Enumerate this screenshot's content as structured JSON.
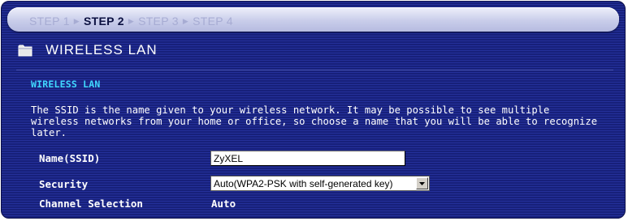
{
  "steps": [
    {
      "label": "STEP 1",
      "active": false
    },
    {
      "label": "STEP 2",
      "active": true
    },
    {
      "label": "STEP 3",
      "active": false
    },
    {
      "label": "STEP 4",
      "active": false
    }
  ],
  "section": {
    "title": "WIRELESS LAN",
    "icon": "folder-icon"
  },
  "subsection": {
    "title": "WIRELESS LAN"
  },
  "description": "The SSID is the name given to your wireless network. It may be possible to see multiple wireless networks from your home or office, so choose a name that you will be able to recognize later.",
  "form": {
    "ssid": {
      "label": "Name(SSID)",
      "value": "ZyXEL"
    },
    "security": {
      "label": "Security",
      "value": "Auto(WPA2-PSK with self-generated key)"
    },
    "channel": {
      "label": "Channel Selection",
      "value": "Auto"
    }
  },
  "colors": {
    "background": "#1f2a8a",
    "accent_subtitle": "#40d8ff",
    "text": "#ffffff",
    "active_step": "#0b1040",
    "inactive_step": "#a7acd3"
  }
}
